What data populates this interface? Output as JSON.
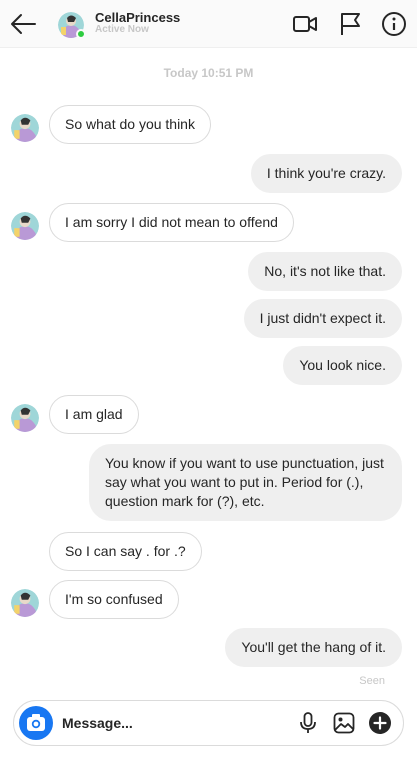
{
  "header": {
    "username": "CellaPrincess",
    "status": "Active Now",
    "icons": [
      "back-arrow-icon",
      "video-call-icon",
      "flag-icon",
      "info-icon"
    ]
  },
  "thread": {
    "timestamp": "Today 10:51 PM",
    "messages": [
      {
        "from": "them",
        "text": "So what do you think"
      },
      {
        "from": "me",
        "text": "I think you're crazy."
      },
      {
        "from": "them",
        "text": "I am sorry I did not mean to offend"
      },
      {
        "from": "me",
        "text": "No, it's not like that."
      },
      {
        "from": "me",
        "text": "I just didn't expect it."
      },
      {
        "from": "me",
        "text": "You look nice."
      },
      {
        "from": "them",
        "text": "I am glad"
      },
      {
        "from": "me",
        "text": "You know if you want to use punctuation, just say what you want to put in. Period for (.), question mark for (?), etc."
      },
      {
        "from": "them",
        "text": "So I can say . for .?"
      },
      {
        "from": "them",
        "text": "I'm so confused"
      },
      {
        "from": "me",
        "text": "You'll get the hang of it."
      }
    ],
    "seen_label": "Seen"
  },
  "composer": {
    "placeholder": "Message...",
    "icons": [
      "camera-icon",
      "microphone-icon",
      "image-icon",
      "plus-icon"
    ]
  },
  "colors": {
    "outgoing_bubble": "#efefef",
    "incoming_border": "#dbdbdb",
    "camera_button": "#1877f2",
    "online_indicator": "#2ecc40"
  }
}
